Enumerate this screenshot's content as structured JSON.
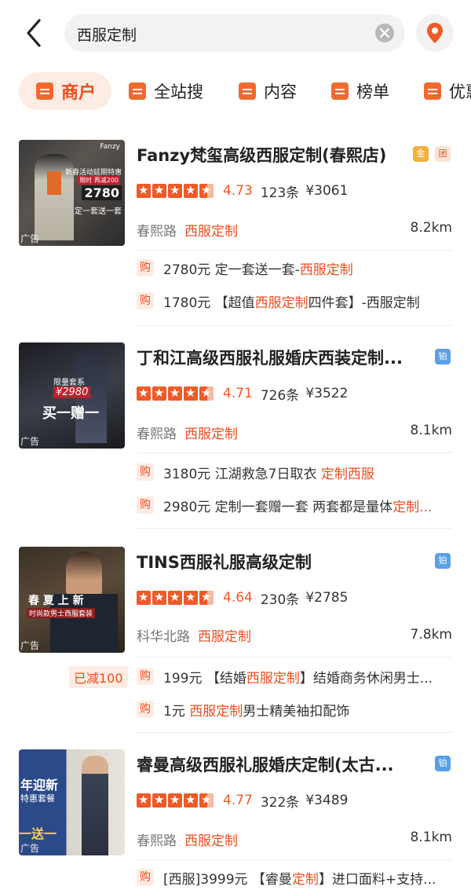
{
  "search": {
    "query": "西服定制"
  },
  "tabs": [
    {
      "label": "商户"
    },
    {
      "label": "全站搜"
    },
    {
      "label": "内容"
    },
    {
      "label": "榜单"
    },
    {
      "label": "优惠"
    }
  ],
  "colors": {
    "accent": "#e8501e",
    "star": "#f05a28",
    "tag_bg": "#fdece4"
  },
  "results": [
    {
      "title": "Fanzy梵玺高级西服定制(春熙店)",
      "rating": 4.5,
      "score": "4.73",
      "reviews": "123条",
      "price": "¥3061",
      "area": "春熙路",
      "category": "西服定制",
      "distance": "8.2km",
      "ad": "广告",
      "thumb_text": {
        "brand": "Fanzy",
        "promo": "新春活动延期特惠",
        "sub": "限时  再减200",
        "price": "2780",
        "slogan": "定一套送一套"
      },
      "deals": [
        {
          "tag": "购",
          "pre": "2780元 定一套送一套-",
          "hl": "西服定制",
          "post": ""
        },
        {
          "tag": "购",
          "pre": "1780元 【超值",
          "hl": "西服定制",
          "post": "四件套】-西服定制"
        }
      ]
    },
    {
      "title": "丁和江高级西服礼服婚庆西装定制...",
      "rating": 4.5,
      "score": "4.71",
      "reviews": "726条",
      "price": "¥3522",
      "area": "春熙路",
      "category": "西服定制",
      "distance": "8.1km",
      "ad": "广告",
      "thumb_text": {
        "promo": "限量套系",
        "price": "¥2980",
        "slogan": "买一赠一"
      },
      "deals": [
        {
          "tag": "购",
          "pre": "3180元 江湖救急7日取衣 ",
          "hl": "定制西服",
          "post": ""
        },
        {
          "tag": "购",
          "pre": "2980元 定制一套赠一套 两套都是量体",
          "hl": "定制...",
          "post": ""
        }
      ]
    },
    {
      "title": "TINS西服礼服高级定制",
      "rating": 4.5,
      "score": "4.64",
      "reviews": "230条",
      "price": "¥2785",
      "area": "科华北路",
      "category": "西服定制",
      "distance": "7.8km",
      "ad": "广告",
      "reduced": "已减100",
      "thumb_text": {
        "slogan": "春 夏 上 新",
        "sub": "时尚款男士西服套装"
      },
      "deals": [
        {
          "tag": "购",
          "pre": "199元 【结婚",
          "hl": "西服定制",
          "post": "】结婚商务休闲男士..."
        },
        {
          "tag": "购",
          "pre": "1元 ",
          "hl": "西服定制",
          "post": "男士精美袖扣配饰"
        }
      ]
    },
    {
      "title": "睿曼高级西服礼服婚庆定制(太古...",
      "rating": 4.5,
      "score": "4.77",
      "reviews": "322条",
      "price": "¥3489",
      "area": "春熙路",
      "category": "西服定制",
      "distance": "8.1km",
      "ad": "广告",
      "thumb_text": {
        "promo": "年迎新",
        "sub": "特惠套餐",
        "slogan": "一送一"
      },
      "deals": [
        {
          "tag": "购",
          "pre": "[西服]3999元 【睿曼",
          "hl": "定制",
          "post": "】进口面料+支持..."
        }
      ]
    }
  ]
}
